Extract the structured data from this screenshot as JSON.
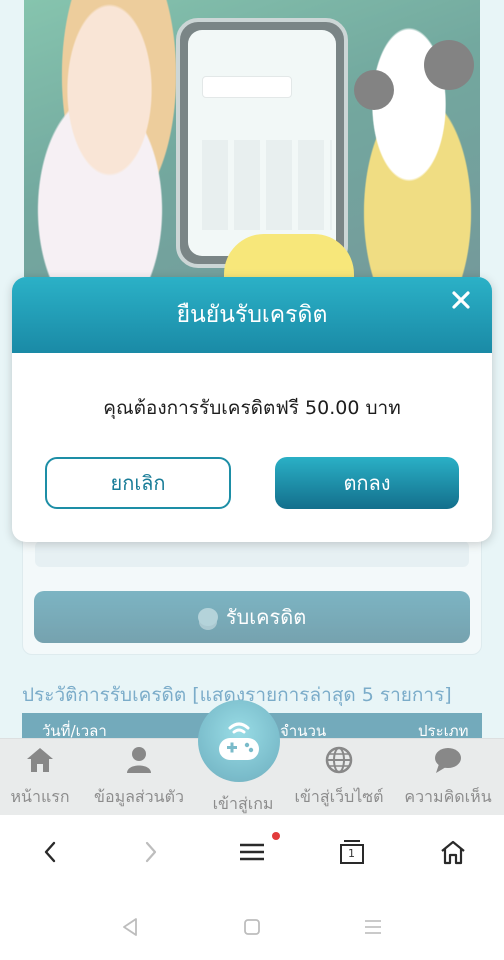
{
  "modal": {
    "title": "ยืนยันรับเครดิต",
    "message": "คุณต้องการรับเครดิตฟรี 50.00 บาท",
    "cancel_label": "ยกเลิก",
    "ok_label": "ตกลง",
    "close_icon": "close-icon"
  },
  "page": {
    "claim_button_label": "รับเครดิต",
    "history_title": "ประวัติการรับเครดิต [แสดงรายการล่าสุด 5 รายการ]",
    "table_headers": [
      "วันที่/เวลา",
      "จำนวน",
      "ประเภท"
    ]
  },
  "bottom_nav": {
    "items": [
      {
        "label": "หน้าแรก",
        "icon": "home-icon"
      },
      {
        "label": "ข้อมูลส่วนตัว",
        "icon": "user-icon"
      },
      {
        "label": "เข้าสู่เกม",
        "icon": "gamepad-icon"
      },
      {
        "label": "เข้าสู่เว็บไซต์",
        "icon": "globe-icon"
      },
      {
        "label": "ความคิดเห็น",
        "icon": "chat-bubble-icon"
      }
    ]
  },
  "browser_bar": {
    "tab_count": "1",
    "icons": [
      "back-icon",
      "forward-icon",
      "menu-icon",
      "tabs-icon",
      "home-icon"
    ]
  },
  "colors": {
    "primary": "#1a8aa6",
    "accent_dark": "#136f8c",
    "notification": "#e23b3b"
  }
}
